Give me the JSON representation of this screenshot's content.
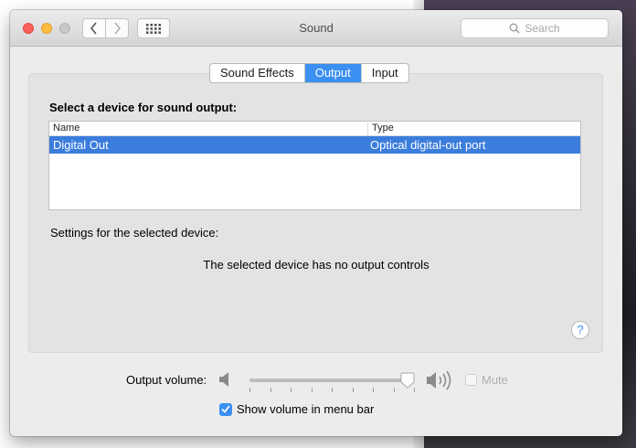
{
  "window": {
    "title": "Sound",
    "search_placeholder": "Search"
  },
  "tabs": [
    {
      "label": "Sound Effects",
      "active": false
    },
    {
      "label": "Output",
      "active": true
    },
    {
      "label": "Input",
      "active": false
    }
  ],
  "output": {
    "section_title": "Select a device for sound output:",
    "columns": {
      "name": "Name",
      "type": "Type"
    },
    "devices": [
      {
        "name": "Digital Out",
        "type": "Optical digital-out port",
        "selected": true
      }
    ],
    "settings_label": "Settings for the selected device:",
    "no_controls_message": "The selected device has no output controls",
    "help_label": "?"
  },
  "footer": {
    "volume_label": "Output volume:",
    "volume_level": 0.96,
    "mute_label": "Mute",
    "mute_checked": false,
    "mute_enabled": false,
    "show_volume_label": "Show volume in menu bar",
    "show_volume_checked": true
  },
  "icons": {
    "back": "chevron-left-icon",
    "forward": "chevron-right-icon",
    "show_all": "grid-icon",
    "search": "search-icon",
    "speaker_low": "speaker-low-icon",
    "speaker_high": "speaker-high-icon",
    "checkmark": "checkmark-icon"
  },
  "colors": {
    "accent": "#3b8ff1",
    "selection": "#3b7ddc",
    "close": "#fc605b",
    "minimize": "#fdbc40"
  }
}
